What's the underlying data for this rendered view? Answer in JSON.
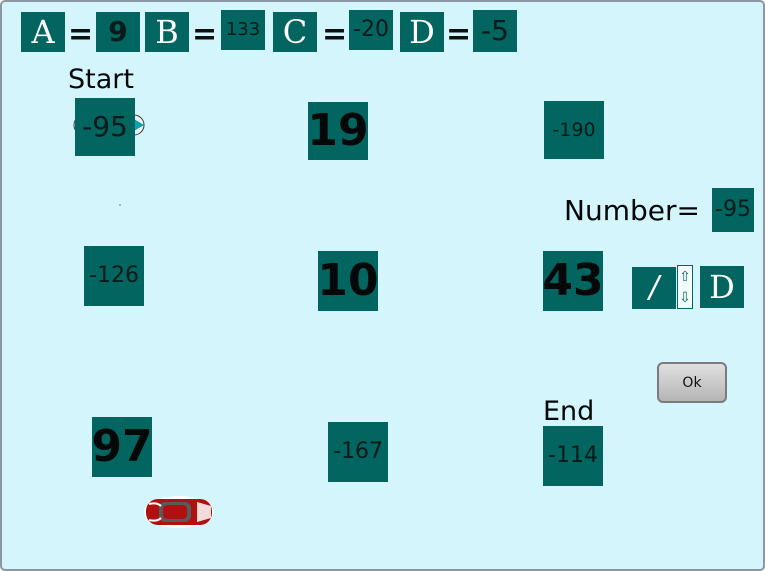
{
  "variables": [
    {
      "letter": "A",
      "value": "9"
    },
    {
      "letter": "B",
      "value": "133"
    },
    {
      "letter": "C",
      "value": "-20"
    },
    {
      "letter": "D",
      "value": "-5"
    }
  ],
  "equals_sign": "=",
  "labels": {
    "start": "Start",
    "end": "End",
    "number": "Number="
  },
  "number_value": "-95",
  "tiles": [
    "-95",
    "19",
    "-190",
    "-126",
    "10",
    "43",
    "97",
    "-167",
    "-114"
  ],
  "operation": {
    "operator": "/",
    "operand": "D",
    "spinner_up": "⇧",
    "spinner_down": "⇩"
  },
  "ok_label": "Ok",
  "colors": {
    "tile": "#03655f",
    "board": "#d3f5fb",
    "car": "#b01010"
  },
  "icons": [
    "car-icon"
  ]
}
